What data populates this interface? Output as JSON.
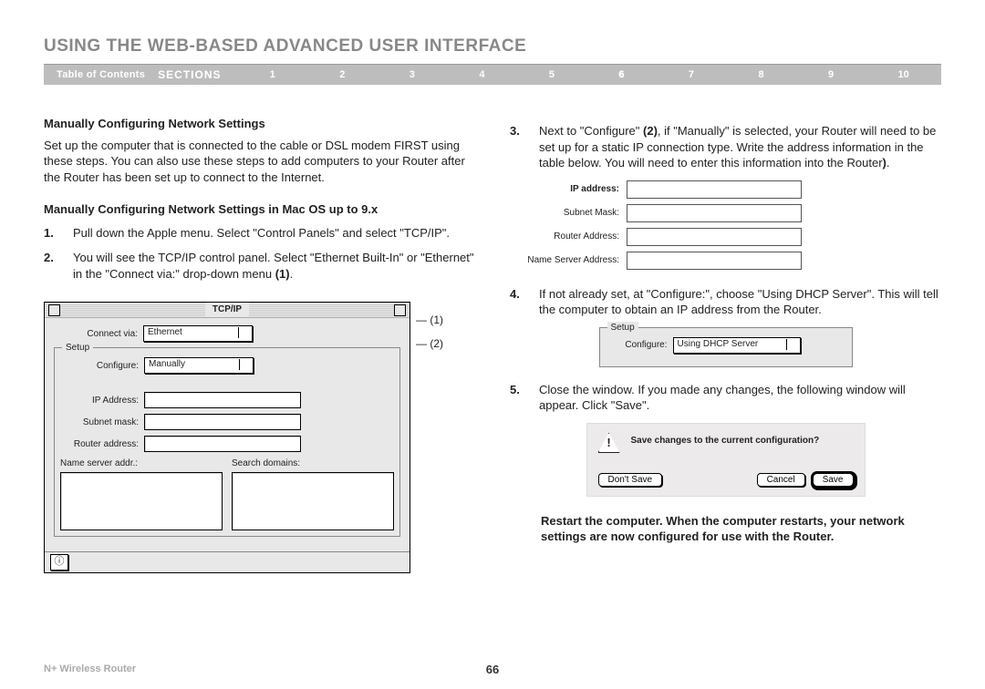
{
  "header": {
    "title": "USING THE WEB-BASED ADVANCED USER INTERFACE",
    "toc": "Table of Contents",
    "sections_label": "SECTIONS",
    "sections": [
      "1",
      "2",
      "3",
      "4",
      "5",
      "6",
      "7",
      "8",
      "9",
      "10"
    ],
    "active_section": "6"
  },
  "left": {
    "h_manual": "Manually Configuring Network Settings",
    "intro": "Set up the computer that is connected to the cable or DSL modem FIRST using these steps. You can also use these steps to add computers to your Router after the Router has been set up to connect to the Internet.",
    "h_mac": "Manually Configuring Network Settings in Mac OS up to 9.x",
    "s1": "Pull down the Apple menu. Select \"Control Panels\" and select \"TCP/IP\".",
    "s2_a": "You will see the TCP/IP control panel. Select \"Ethernet Built-In\" or \"Ethernet\" in the \"Connect via:\" drop-down menu ",
    "s2_b": "(1)",
    "s2_c": ".",
    "tcpip": {
      "title": "TCP/IP",
      "connect_via_label": "Connect via:",
      "connect_via_value": "Ethernet",
      "setup_label": "Setup",
      "configure_label": "Configure:",
      "configure_value": "Manually",
      "ip_label": "IP Address:",
      "subnet_label": "Subnet mask:",
      "router_label": "Router address:",
      "ns_label": "Name server addr.:",
      "search_label": "Search domains:",
      "callout1": "(1)",
      "callout2": "(2)"
    }
  },
  "right": {
    "s3_a": "Next to \"Configure\" ",
    "s3_b": "(2)",
    "s3_c": ", if \"Manually\" is selected, your Router will need to be set up for a static IP connection type. Write the address information in the table below. You will need to enter this information into the Router",
    "s3_d": ")",
    "s3_e": ".",
    "fields": {
      "ip": "IP address:",
      "subnet": "Subnet Mask:",
      "router": "Router Address:",
      "ns": "Name Server Address:"
    },
    "s4": "If not already set, at \"Configure:\", choose \"Using DHCP Server\". This will tell the computer to obtain an IP address from the Router.",
    "dhcp": {
      "setup_label": "Setup",
      "configure_label": "Configure:",
      "configure_value": "Using DHCP Server"
    },
    "s5": "Close the window. If you made any changes, the following window will appear. Click \"Save\".",
    "dialog": {
      "msg": "Save changes to the current configuration?",
      "dont_save": "Don't Save",
      "cancel": "Cancel",
      "save": "Save"
    },
    "restart": "Restart the computer. When the computer restarts, your network settings are now configured for use with the Router."
  },
  "footer": {
    "product": "N+ Wireless Router",
    "page": "66"
  }
}
